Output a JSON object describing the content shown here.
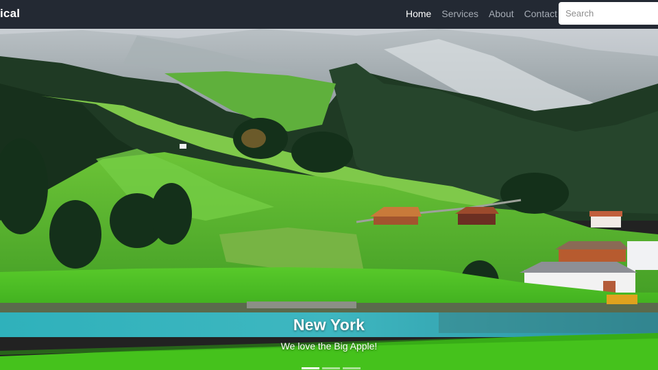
{
  "navbar": {
    "brand": "ical",
    "links": [
      {
        "label": "Home",
        "active": true
      },
      {
        "label": "Services",
        "active": false
      },
      {
        "label": "About",
        "active": false
      },
      {
        "label": "Contact",
        "active": false
      }
    ],
    "search_placeholder": "Search"
  },
  "carousel": {
    "title": "New York",
    "text": "We love the Big Apple!",
    "slide_count": 3,
    "active_slide": 1
  },
  "colors": {
    "navbar_bg": "#232933",
    "nav_active": "#ffffff",
    "nav_inactive": "#a5abb4",
    "grass": "#4fbf2a",
    "lake": "#2fa7b5"
  }
}
